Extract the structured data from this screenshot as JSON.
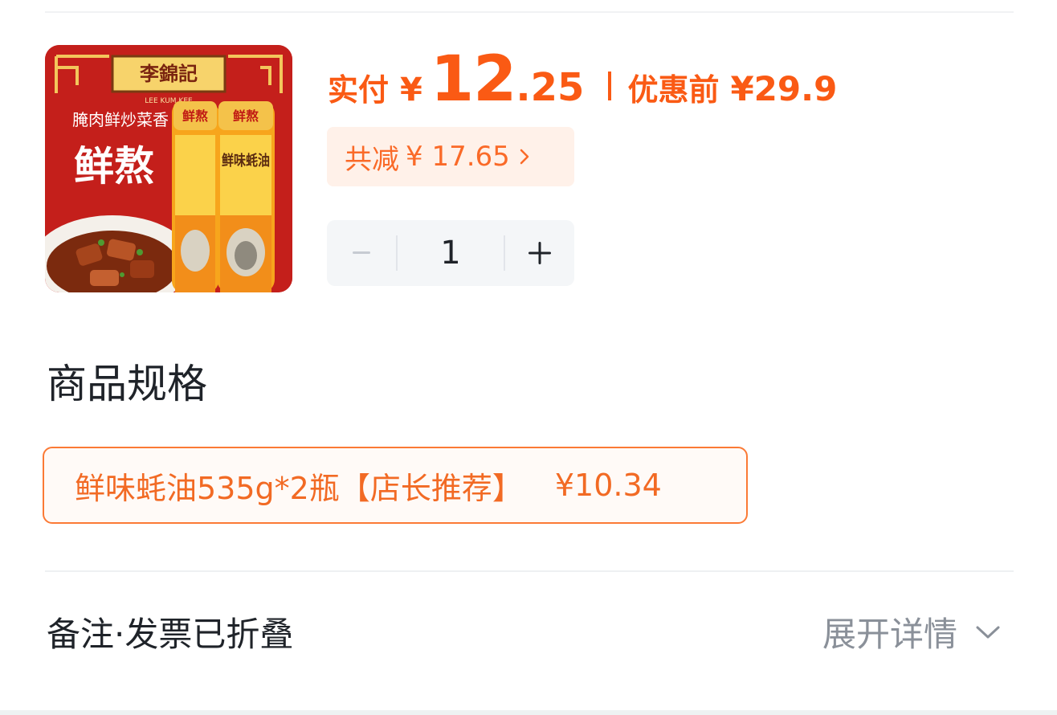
{
  "product": {
    "image_brand_text": "李錦記",
    "image_brand_sub": "LEE KUM KEE",
    "image_tagline": "腌肉鲜炒菜香",
    "image_big_text": "鲜熬",
    "image_bottle_cap": "鲜熬",
    "image_bottle_text": "鲜味蚝油"
  },
  "price": {
    "paid_label": "实付",
    "currency": "¥",
    "paid_int": "12",
    "paid_dec": ".25",
    "original_label": "优惠前",
    "original_price": "¥29.9"
  },
  "discount": {
    "label": "共减",
    "amount": "¥ 17.65"
  },
  "quantity": {
    "minus": "−",
    "value": "1",
    "plus": "+"
  },
  "spec": {
    "title": "商品规格",
    "option_name": "鲜味蚝油535g*2瓶【店长推荐】",
    "option_price": "¥10.34"
  },
  "remark": {
    "label": "备注·发票已折叠",
    "expand_label": "展开详情"
  },
  "colors": {
    "accent": "#fa5a14",
    "chip_bg": "#fff1e9",
    "stepper_bg": "#f4f6f8"
  }
}
